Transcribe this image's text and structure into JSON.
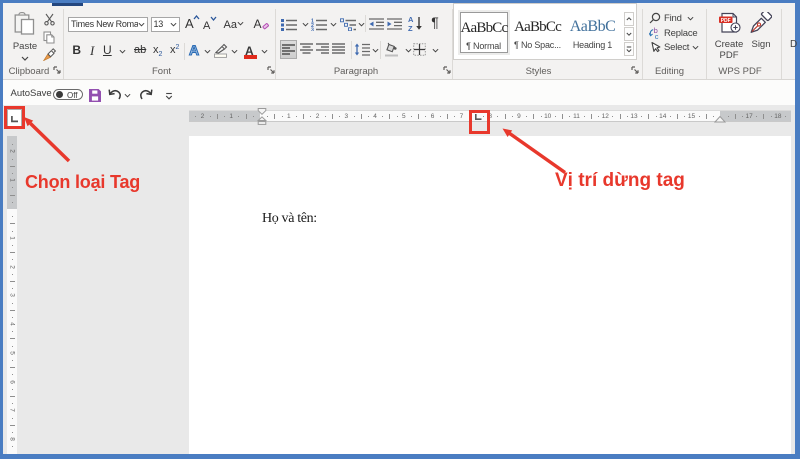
{
  "ribbon": {
    "clipboard": {
      "label": "Clipboard",
      "paste": "Paste"
    },
    "font": {
      "label": "Font",
      "font_name": "Times New Roma",
      "font_size": "13",
      "bold": "B",
      "italic": "I",
      "underline": "U",
      "grow": "A",
      "shrink": "A",
      "strike": "ab",
      "sub": "x",
      "sup": "x",
      "sub2": "2",
      "sup2": "2",
      "effects": "A",
      "fontcolor": "A",
      "case": "Aa",
      "clear": "A"
    },
    "paragraph": {
      "label": "Paragraph",
      "pilcrow": "¶",
      "sortA": "A",
      "sortZ": "Z",
      "numbering_glyphs": [
        "1",
        "2",
        "3"
      ]
    },
    "styles": {
      "label": "Styles",
      "cards": [
        {
          "sample": "AaBbCc",
          "name": "¶ Normal",
          "selected": true
        },
        {
          "sample": "AaBbCc",
          "name": "¶ No Spac...",
          "selected": false
        },
        {
          "sample": "AaBbC",
          "name": "Heading 1",
          "selected": false
        }
      ]
    },
    "editing": {
      "label": "Editing",
      "find": "Find",
      "replace": "Replace",
      "select": "Select",
      "replace_glyphs": [
        "b",
        "c"
      ]
    },
    "wps": {
      "label": "WPS PDF",
      "create_line1": "Create",
      "create_line2": "PDF",
      "badge": "PDF",
      "sign": "Sign"
    },
    "next_group_cut": "D"
  },
  "qat": {
    "autosave": "AutoSave",
    "autosave_state": "Off"
  },
  "ruler": {
    "tab_stop_cm": 7.5,
    "h_margin_left_numbers": [
      "2",
      "1"
    ],
    "h_numbers": [
      "1",
      "2",
      "3",
      "4",
      "5",
      "6",
      "7",
      "8",
      "9",
      "10",
      "11",
      "12",
      "13",
      "14",
      "15"
    ],
    "h_margin_right_numbers": [
      "17",
      "18"
    ],
    "v_margin_numbers": [
      "2",
      "1"
    ],
    "v_numbers": [
      "1",
      "2",
      "3",
      "4",
      "5",
      "6",
      "7",
      "8"
    ]
  },
  "document": {
    "text": "Họ và tên:"
  },
  "annotations": {
    "label1": "Chọn loại Tag",
    "label2": "Vị trí dừng tag",
    "red": "#e8382c"
  }
}
